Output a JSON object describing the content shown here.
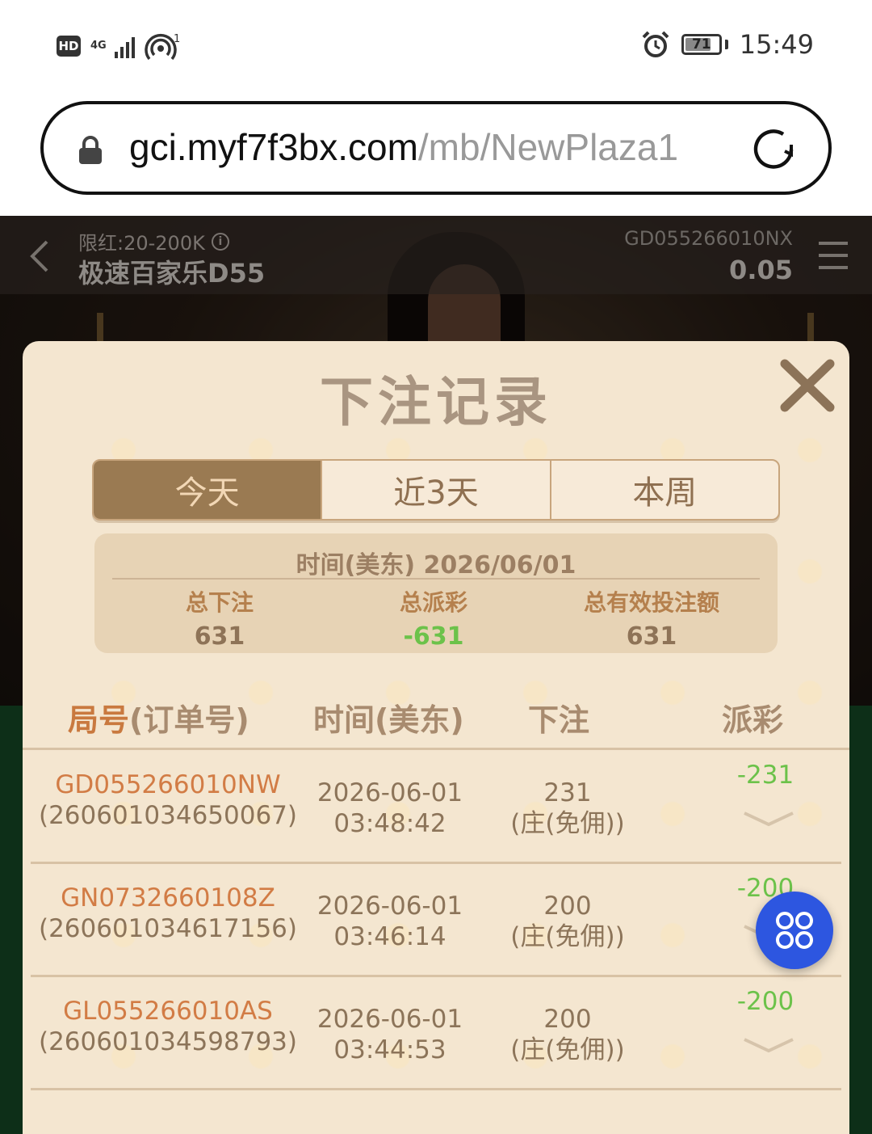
{
  "status_bar": {
    "hd": "HD",
    "network": "4G",
    "hotspot_count": "1",
    "battery": "71",
    "time": "15:49"
  },
  "browser": {
    "url_domain": "gci.myf7f3bx.com",
    "url_path": "/mb/NewPlaza1"
  },
  "game": {
    "limit": "限红:20-200K",
    "table_name": "极速百家乐D55",
    "round_id": "GD055266010NX",
    "balance": "0.05"
  },
  "modal": {
    "title": "下注记录",
    "tabs": [
      {
        "label": "今天",
        "active": true
      },
      {
        "label": "近3天",
        "active": false
      },
      {
        "label": "本周",
        "active": false
      }
    ],
    "summary": {
      "date_line": "时间(美东) 2026/06/01",
      "total_bet_label": "总下注",
      "total_bet": "631",
      "total_payout_label": "总派彩",
      "total_payout": "-631",
      "total_valid_label": "总有效投注额",
      "total_valid": "631"
    },
    "table": {
      "headers": {
        "round_main": "局号",
        "round_sub": "(订单号)",
        "time": "时间(美东)",
        "bet": "下注",
        "payout": "派彩"
      },
      "rows": [
        {
          "round": "GD055266010NW",
          "order": "(260601034650067)",
          "date": "2026-06-01",
          "time": "03:48:42",
          "amount": "231",
          "bet_type": "(庄(免佣))",
          "payout": "-231"
        },
        {
          "round": "GN0732660108Z",
          "order": "(260601034617156)",
          "date": "2026-06-01",
          "time": "03:46:14",
          "amount": "200",
          "bet_type": "(庄(免佣))",
          "payout": "-200"
        },
        {
          "round": "GL055266010AS",
          "order": "(260601034598793)",
          "date": "2026-06-01",
          "time": "03:44:53",
          "amount": "200",
          "bet_type": "(庄(免佣))",
          "payout": "-200"
        }
      ]
    }
  },
  "colors": {
    "accent_brown": "#9a7a52",
    "negative_green": "#6cc24a",
    "round_orange": "#d27c45",
    "fab_blue": "#2d56e0"
  }
}
